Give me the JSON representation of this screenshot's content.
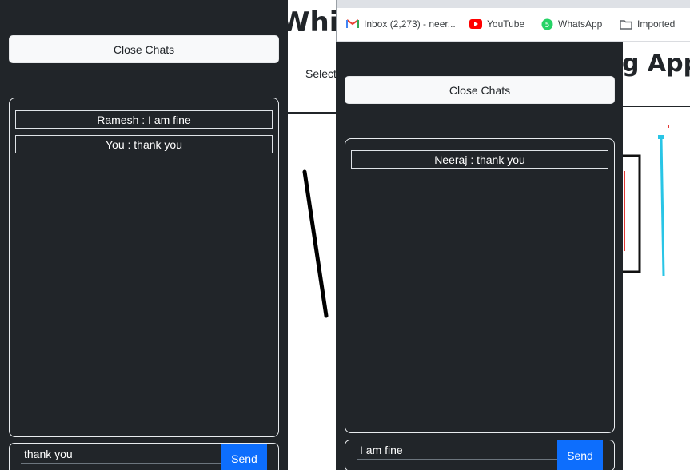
{
  "background_app": {
    "title_fragment": "Whit",
    "select_fragment": "Select"
  },
  "left_chat": {
    "close_button": "Close Chats",
    "messages": [
      {
        "text": "Ramesh : I am fine"
      },
      {
        "text": "You : thank you"
      }
    ],
    "input_value": "thank you",
    "send_button": "Send"
  },
  "browser": {
    "bookmarks": [
      {
        "label": "Inbox (2,273) - neer...",
        "icon": "gmail-icon"
      },
      {
        "label": "YouTube",
        "icon": "youtube-icon"
      },
      {
        "label": "WhatsApp",
        "icon": "whatsapp-icon"
      },
      {
        "label": "Imported",
        "icon": "folder-icon"
      }
    ]
  },
  "right_app": {
    "title_fragment": "g App"
  },
  "right_chat": {
    "close_button": "Close Chats",
    "messages": [
      {
        "text": "Neeraj : thank you"
      }
    ],
    "input_value": "I am fine",
    "send_button": "Send"
  },
  "colors": {
    "panel_bg": "#212529",
    "send_bg": "#0d6efd",
    "accent_red": "#e53935",
    "accent_cyan": "#29c5e6"
  }
}
